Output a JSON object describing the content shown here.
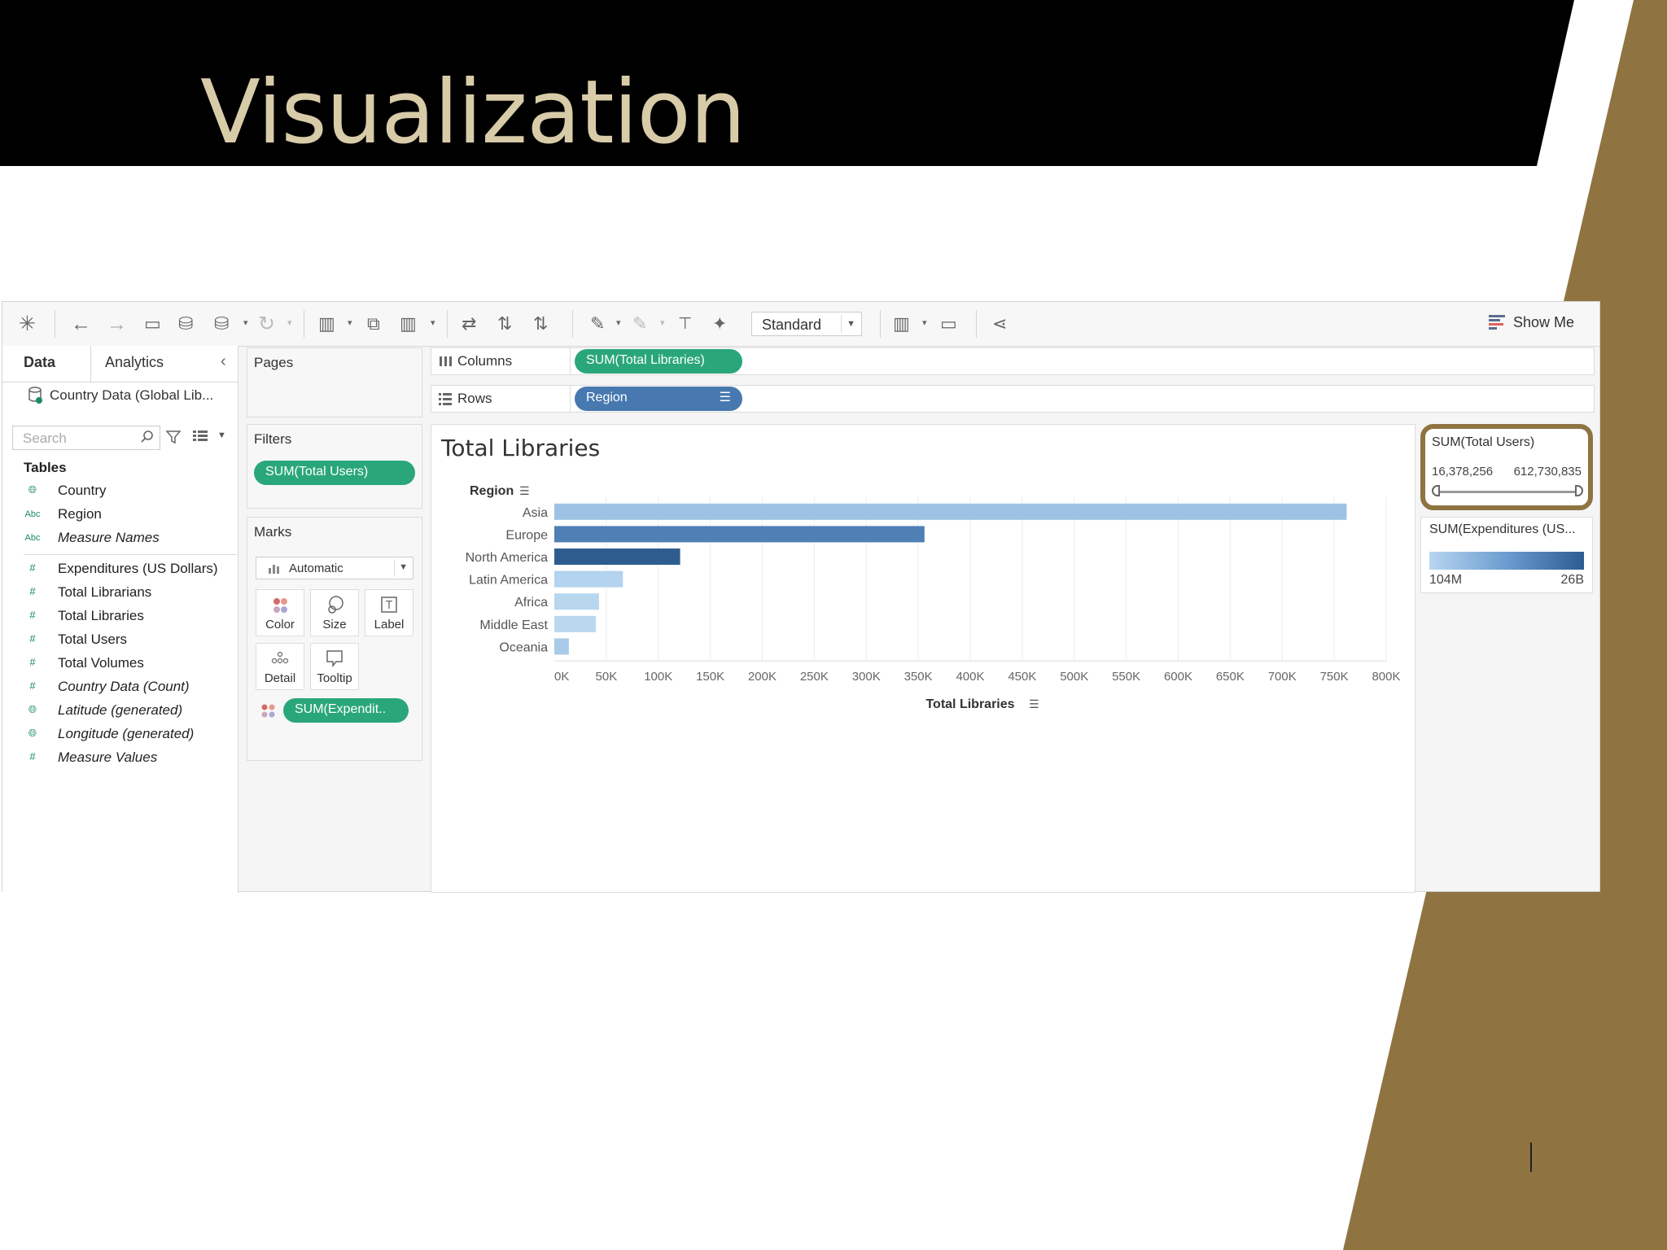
{
  "slide": {
    "title": "Visualization",
    "colors": {
      "banner": "#000000",
      "accent_gold": "#8f7442",
      "title_text": "#d8cba8"
    }
  },
  "toolbar": {
    "fit_select": "Standard",
    "show_me": "Show Me"
  },
  "data_pane": {
    "tabs": [
      "Data",
      "Analytics"
    ],
    "datasource": "Country Data (Global Lib...",
    "search_placeholder": "Search",
    "tables_heading": "Tables",
    "fields": [
      {
        "type": "geo",
        "icon": "globe-icon",
        "label": "Country",
        "italic": false
      },
      {
        "type": "abc",
        "icon": "Abc",
        "label": "Region",
        "italic": false
      },
      {
        "type": "abc",
        "icon": "Abc",
        "label": "Measure Names",
        "italic": true
      },
      {
        "type": "num",
        "icon": "#",
        "label": "Expenditures (US Dollars)",
        "italic": false
      },
      {
        "type": "num",
        "icon": "#",
        "label": "Total Librarians",
        "italic": false
      },
      {
        "type": "num",
        "icon": "#",
        "label": "Total Libraries",
        "italic": false
      },
      {
        "type": "num",
        "icon": "#",
        "label": "Total Users",
        "italic": false
      },
      {
        "type": "num",
        "icon": "#",
        "label": "Total Volumes",
        "italic": false
      },
      {
        "type": "num",
        "icon": "#",
        "label": "Country Data (Count)",
        "italic": true
      },
      {
        "type": "geo",
        "icon": "globe-icon",
        "label": "Latitude (generated)",
        "italic": true
      },
      {
        "type": "geo",
        "icon": "globe-icon",
        "label": "Longitude (generated)",
        "italic": true
      },
      {
        "type": "num",
        "icon": "#",
        "label": "Measure Values",
        "italic": true
      }
    ]
  },
  "shelves": {
    "pages": "Pages",
    "filters": "Filters",
    "filter_pill": "SUM(Total Users)",
    "marks": "Marks",
    "marks_type": "Automatic",
    "mark_buttons": [
      "Color",
      "Size",
      "Label",
      "Detail",
      "Tooltip"
    ],
    "marks_pill": "SUM(Expendit..",
    "columns_label": "Columns",
    "columns_pill": "SUM(Total Libraries)",
    "rows_label": "Rows",
    "rows_pill": "Region"
  },
  "legends": {
    "users": {
      "title": "SUM(Total Users)",
      "min": "16,378,256",
      "max": "612,730,835"
    },
    "expenditures": {
      "title": "SUM(Expenditures (US...",
      "min": "104M",
      "max": "26B",
      "ramp_colors": [
        "#b7d6f0",
        "#2b5d93"
      ]
    }
  },
  "chart_data": {
    "type": "bar",
    "orientation": "horizontal",
    "title": "Total Libraries",
    "row_header": "Region",
    "xlabel": "Total Libraries",
    "categories": [
      "Asia",
      "Europe",
      "North America",
      "Latin America",
      "Africa",
      "Middle East",
      "Oceania"
    ],
    "values": [
      762000,
      356000,
      121000,
      66000,
      43000,
      40000,
      14000
    ],
    "colors": [
      "#9dc2e3",
      "#4f7fb5",
      "#2e5c8f",
      "#b3d3ee",
      "#b8d7ef",
      "#b9d8f0",
      "#a8cbe9"
    ],
    "xlim": [
      0,
      800000
    ],
    "xticks": [
      "0K",
      "50K",
      "100K",
      "150K",
      "200K",
      "250K",
      "300K",
      "350K",
      "400K",
      "450K",
      "500K",
      "550K",
      "600K",
      "650K",
      "700K",
      "750K",
      "800K"
    ],
    "grid": true
  },
  "footer": {
    "page_number": ""
  }
}
